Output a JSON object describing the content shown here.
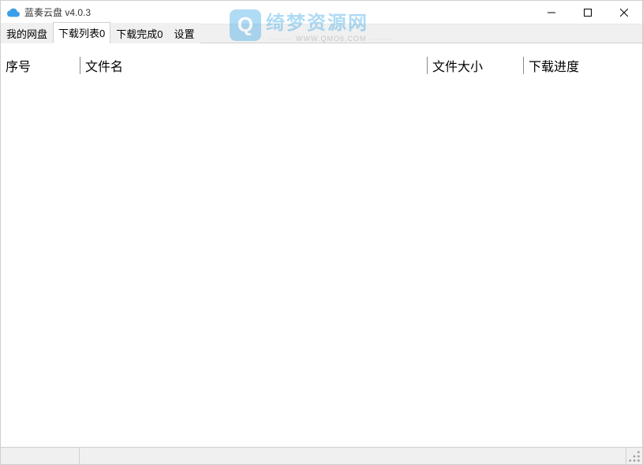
{
  "window": {
    "title": "蓝奏云盘 v4.0.3"
  },
  "tabs": [
    {
      "label": "我的网盘",
      "active": false
    },
    {
      "label": "下载列表0",
      "active": true
    },
    {
      "label": "下载完成0",
      "active": false
    },
    {
      "label": "设置",
      "active": false
    }
  ],
  "columns": {
    "index": "序号",
    "filename": "文件名",
    "filesize": "文件大小",
    "progress": "下载进度"
  },
  "watermark": {
    "badge": "Q",
    "main": "绮梦资源网",
    "sub": "WWW.QMO6.COM"
  }
}
